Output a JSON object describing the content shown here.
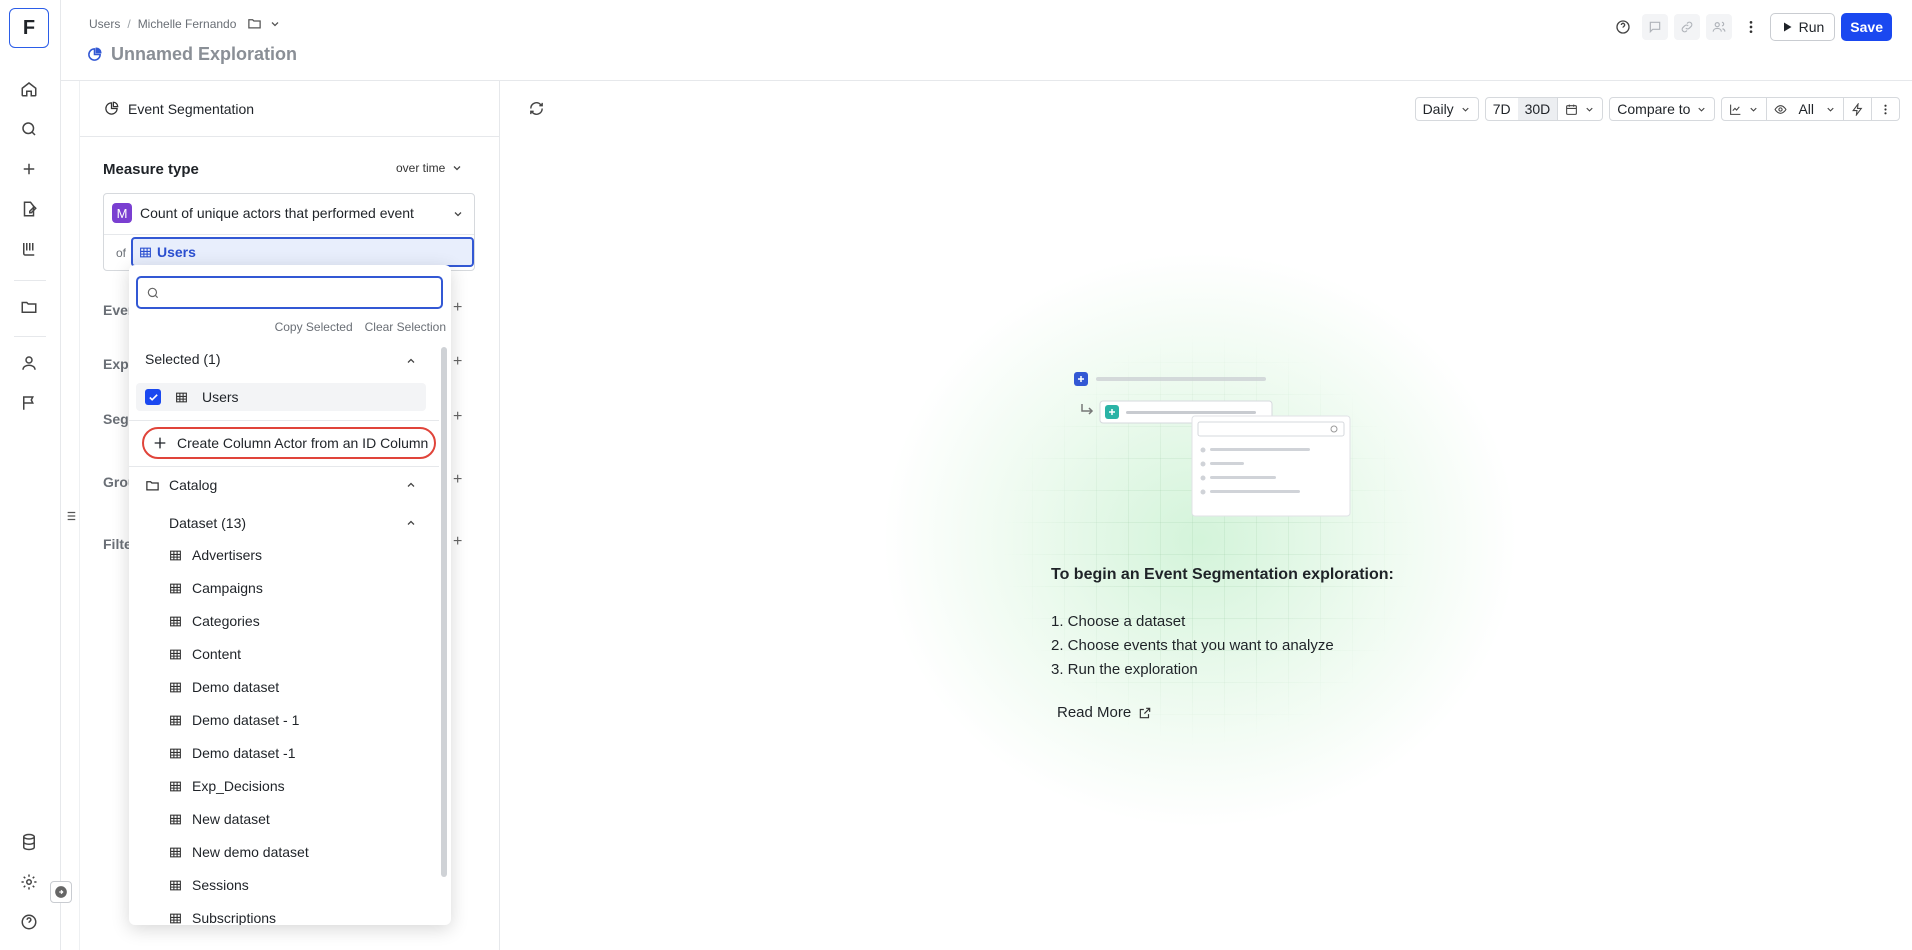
{
  "rail": {
    "logo": "F"
  },
  "breadcrumb": {
    "root": "Users",
    "sep": "/",
    "owner": "Michelle Fernando"
  },
  "page": {
    "title": "Unnamed Exploration"
  },
  "topbar": {
    "run_label": "Run",
    "save_label": "Save"
  },
  "panel": {
    "heading": "Event Segmentation",
    "measure_type_label": "Measure type",
    "measure_mode": "over time",
    "measure_value": "Count of unique actors that performed event",
    "measure_badge": "M",
    "of_label": "of",
    "actor_selected": "Users",
    "sections": [
      "Ever",
      "Expe",
      "Segr",
      "Grou",
      "Filte"
    ]
  },
  "dropdown": {
    "search_placeholder": "",
    "copy_selected": "Copy Selected",
    "clear_selection": "Clear Selection",
    "selected_header": "Selected (1)",
    "selected_item": "Users",
    "create_label": "Create Column Actor from an ID Column",
    "catalog_label": "Catalog",
    "dataset_header": "Dataset (13)",
    "datasets": [
      "Advertisers",
      "Campaigns",
      "Categories",
      "Content",
      "Demo dataset",
      "Demo dataset - 1",
      "Demo dataset -1",
      "Exp_Decisions",
      "New dataset",
      "New demo dataset",
      "Sessions",
      "Subscriptions"
    ]
  },
  "toolbar": {
    "granularity": "Daily",
    "range_7d": "7D",
    "range_30d": "30D",
    "compare": "Compare to",
    "visibility": "All"
  },
  "empty_state": {
    "heading": "To begin an Event Segmentation exploration:",
    "steps": [
      "1. Choose a dataset",
      "2. Choose events that you want to analyze",
      "3. Run the exploration"
    ],
    "read_more": "Read More"
  },
  "colors": {
    "accent": "#1a48f0",
    "measure_badge": "#7a3fd1",
    "highlight": "#e0443a"
  }
}
